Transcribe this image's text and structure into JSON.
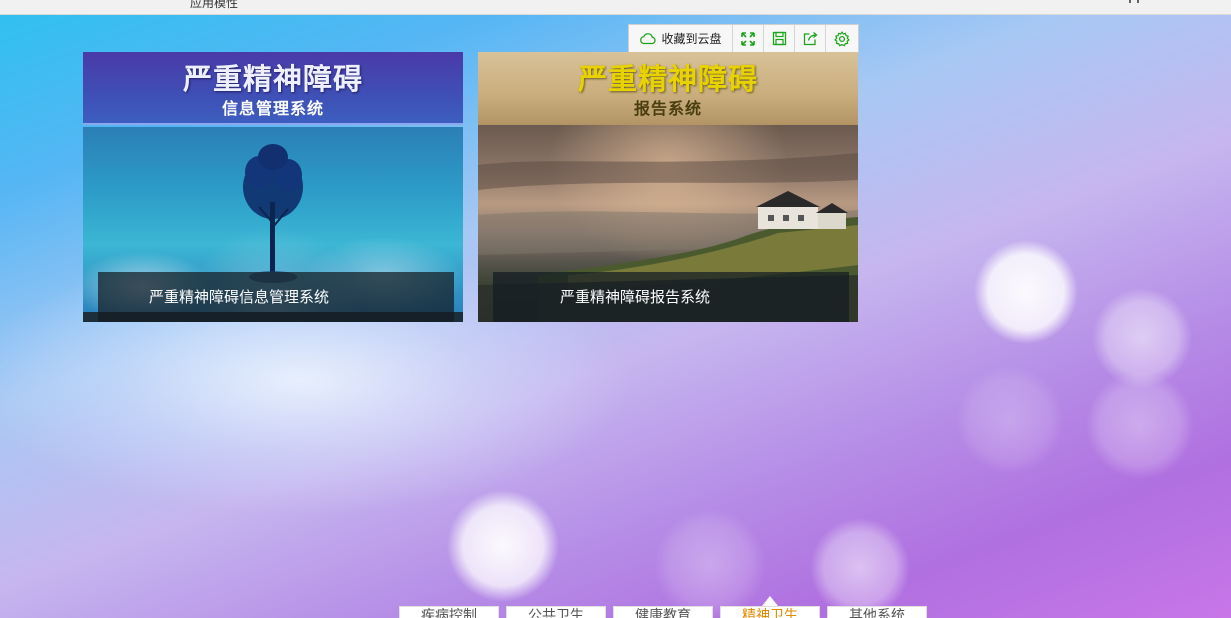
{
  "topbar": {
    "title": "应用模性",
    "right_icon": "user-icon"
  },
  "toolbar": {
    "save_to_cloud_label": "收藏到云盘",
    "icons": [
      "cloud-icon",
      "fullscreen-icon",
      "save-icon",
      "share-icon",
      "settings-icon"
    ],
    "accent_color": "#1aa51a"
  },
  "tiles": [
    {
      "banner_title": "严重精神障碍",
      "banner_subtitle": "信息管理系统",
      "caption": "严重精神障碍信息管理系统"
    },
    {
      "banner_title": "严重精神障碍",
      "banner_subtitle": "报告系统",
      "caption": "严重精神障碍报告系统"
    }
  ],
  "bottom_tabs": [
    {
      "label": "疾病控制",
      "active": false
    },
    {
      "label": "公共卫生",
      "active": false
    },
    {
      "label": "健康教育",
      "active": false
    },
    {
      "label": "精神卫生",
      "active": true
    },
    {
      "label": "其他系统",
      "active": false
    }
  ]
}
